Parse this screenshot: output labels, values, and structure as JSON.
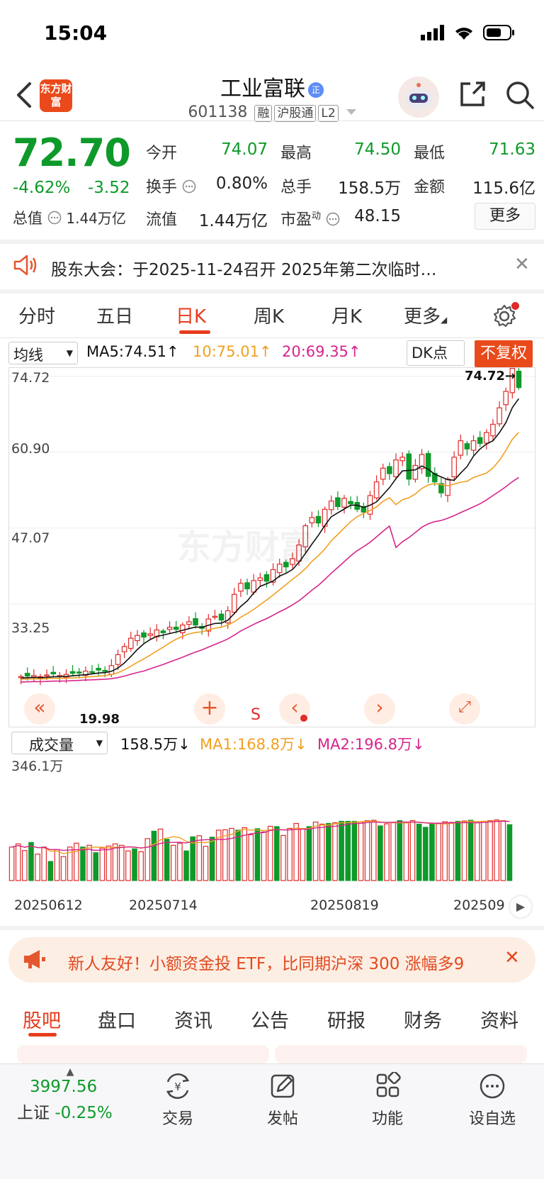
{
  "status_bar": {
    "time": "15:04"
  },
  "header": {
    "logo_text": "东方财富",
    "stock_name": "工业富联",
    "name_badge": "正",
    "stock_code": "601138",
    "tags": [
      "融",
      "沪股通",
      "L2"
    ]
  },
  "quote": {
    "price": "72.70",
    "change_pct": "-4.62%",
    "change": "-3.52",
    "market_cap_label": "总值",
    "market_cap": "1.44万亿",
    "fields": [
      {
        "label": "今开",
        "value": "74.07"
      },
      {
        "label": "最高",
        "value": "74.50"
      },
      {
        "label": "最低",
        "value": "71.63"
      },
      {
        "label": "换手",
        "value": "0.80%"
      },
      {
        "label": "总手",
        "value": "158.5万"
      },
      {
        "label": "金额",
        "value": "115.6亿"
      },
      {
        "label": "流值",
        "value": "1.44万亿"
      },
      {
        "label": "市盈",
        "value": "48.15"
      }
    ],
    "pe_superscript": "动",
    "more_label": "更多"
  },
  "notice": {
    "text": "股东大会：于2025-11-24召开 2025年第二次临时…"
  },
  "period_tabs": [
    "分时",
    "五日",
    "日K",
    "周K",
    "月K",
    "更多"
  ],
  "active_period": "日K",
  "indicators": {
    "ma_selector": "均线",
    "ma5": "MA5:74.51↑",
    "ma10": "10:75.01↑",
    "ma20": "20:69.35↑",
    "dk_label": "DK点",
    "no_adjust_label": "不复权",
    "vol_selector": "成交量",
    "vol_value": "158.5万↓",
    "vol_ma1": "MA1:168.8万↓",
    "vol_ma2": "MA2:196.8万↓"
  },
  "chart_data": [
    {
      "type": "candlestick",
      "title": "",
      "y_ticks": [
        "74.72",
        "60.90",
        "47.07",
        "33.25"
      ],
      "ylim": [
        19.4,
        74.72
      ],
      "annotations": {
        "high_marker": "74.72→",
        "low_marker": "19.98",
        "signal": "S"
      },
      "colors": {
        "up": "#e02b2b",
        "down": "#0e9a2a",
        "ma5": "#111111",
        "ma10": "#f0a020",
        "ma20": "#d6258c"
      },
      "close_path": [
        20.0,
        20.1,
        20.2,
        20.0,
        20.3,
        20.5,
        20.2,
        20.4,
        20.6,
        20.8,
        21.0,
        20.9,
        21.2,
        21.0,
        22.0,
        24.0,
        25.5,
        27.0,
        27.5,
        27.2,
        27.8,
        28.5,
        28.0,
        29.0,
        28.6,
        29.4,
        30.0,
        29.4,
        28.8,
        30.5,
        31.0,
        30.3,
        32.0,
        35.0,
        37.0,
        36.0,
        37.5,
        38.0,
        37.4,
        39.5,
        40.5,
        40.0,
        41.5,
        44.0,
        47.5,
        49.0,
        48.0,
        50.5,
        52.0,
        51.0,
        52.5,
        51.5,
        50.5,
        50.0,
        53.0,
        55.5,
        58.0,
        57.0,
        59.5,
        60.0,
        56.0,
        58.5,
        60.5,
        56.5,
        55.5,
        53.5,
        56.0,
        60.0,
        63.0,
        61.5,
        63.0,
        62.5,
        64.5,
        66.0,
        69.0,
        72.0,
        76.2,
        72.7
      ],
      "x_labels": [
        "20250612",
        "20250714",
        "20250819",
        "202509"
      ]
    },
    {
      "type": "bar",
      "title": "",
      "y_ticks": [
        "346.1万"
      ],
      "ylim": [
        0,
        346.1
      ],
      "volume_path": [
        95,
        104,
        85,
        108,
        75,
        95,
        54,
        88,
        68,
        95,
        106,
        95,
        100,
        79,
        92,
        98,
        104,
        100,
        84,
        90,
        82,
        119,
        140,
        146,
        117,
        100,
        106,
        84,
        124,
        127,
        97,
        123,
        143,
        144,
        148,
        143,
        150,
        130,
        147,
        138,
        154,
        153,
        128,
        148,
        162,
        146,
        153,
        166,
        160,
        162,
        164,
        168,
        168,
        168,
        166,
        170,
        171,
        155,
        161,
        164,
        170,
        166,
        170,
        160,
        151,
        162,
        163,
        167,
        165,
        168,
        169,
        171,
        164,
        168,
        170,
        172,
        170,
        158.5
      ]
    }
  ],
  "promo": {
    "text": "新人友好！小额资金投 ETF，比同期沪深 300 涨幅多9"
  },
  "bottom_tabs": [
    "股吧",
    "盘口",
    "资讯",
    "公告",
    "研报",
    "财务",
    "资料"
  ],
  "bottom_nav": {
    "index_value": "3997.56",
    "index_name": "上证",
    "index_change": "-0.25%",
    "items": [
      "交易",
      "发帖",
      "功能",
      "设自选"
    ]
  },
  "watermark": "东方财富"
}
